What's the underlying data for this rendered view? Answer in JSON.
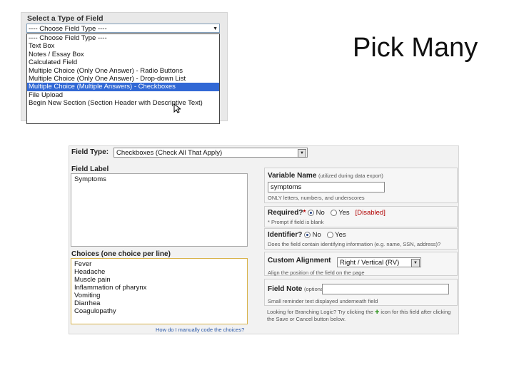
{
  "slide": {
    "title": "Pick Many"
  },
  "type_picker": {
    "heading": "Select a Type of Field",
    "select_value": "---- Choose Field Type ----",
    "options": [
      "---- Choose Field Type ----",
      "Text Box",
      "Notes / Essay Box",
      "Calculated Field",
      "Multiple Choice (Only One Answer) - Radio Buttons",
      "Multiple Choice (Only One Answer) - Drop-down List",
      "Multiple Choice (Multiple Answers) - Checkboxes",
      "File Upload",
      "Begin New Section (Section Header with Descriptive Text)"
    ],
    "selected_index": 6
  },
  "field_form": {
    "field_type_label": "Field Type:",
    "field_type_value": "Checkboxes (Check All That Apply)",
    "field_label_heading": "Field Label",
    "field_label_value": "Symptoms",
    "variable_name": {
      "label": "Variable Name",
      "label_note": "(utilized during data export)",
      "value": "symptoms",
      "hint": "ONLY letters, numbers, and underscores"
    },
    "required": {
      "label": "Required?",
      "marker": "*",
      "no_label": "No",
      "yes_label": "Yes",
      "status": "[Disabled]",
      "hint": "* Prompt if field is blank"
    },
    "identifier": {
      "label": "Identifier?",
      "no_label": "No",
      "yes_label": "Yes",
      "hint": "Does the field contain identifying information (e.g. name, SSN, address)?"
    },
    "custom_alignment": {
      "label": "Custom Alignment",
      "value": "Right / Vertical (RV)",
      "hint": "Align the position of the field on the page"
    },
    "field_note": {
      "label": "Field Note",
      "label_note": "(optional)",
      "value": "",
      "hint": "Small reminder text displayed underneath field"
    },
    "branching_hint_1": "Looking for Branching Logic? Try clicking the",
    "branching_hint_2": "icon for this field after",
    "branching_hint_3": "clicking the Save or Cancel button below.",
    "choices_heading": "Choices (one choice per line)",
    "choices": [
      "Fever",
      "Headache",
      "Muscle pain",
      "Inflammation of pharynx",
      "Vomiting",
      "Diarrhea",
      "Coagulopathy"
    ],
    "manual_code_link": "How do I manually code the choices?"
  }
}
